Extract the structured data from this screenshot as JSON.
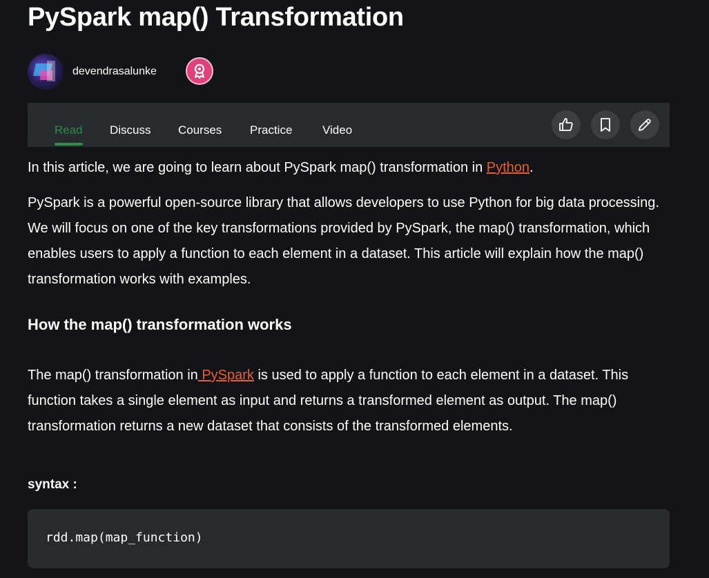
{
  "article": {
    "title": "PySpark map() Transformation",
    "author": "devendrasalunke"
  },
  "icons": {
    "badge": "award-badge-icon",
    "like": "thumbs-up-icon",
    "bookmark": "bookmark-icon",
    "edit": "pencil-icon"
  },
  "tabs": [
    {
      "label": "Read",
      "active": true
    },
    {
      "label": "Discuss",
      "active": false
    },
    {
      "label": "Courses",
      "active": false
    },
    {
      "label": "Practice",
      "active": false
    },
    {
      "label": "Video",
      "active": false
    }
  ],
  "content": {
    "intro": {
      "before": "In this article, we are going to learn about PySpark map() transformation in ",
      "link": "Python",
      "after": "."
    },
    "para1": "PySpark is a powerful open-source library that allows developers to use Python for big data processing. We will focus on one of the key transformations provided by PySpark, the map() transformation, which enables users to apply a function to each element in a dataset. This article will explain how the map() transformation works with examples.",
    "heading": "How the map() transformation works",
    "para2": {
      "before": "The map() transformation in",
      "link": " PySpark",
      "after": " is used to apply a function to each element in a dataset. This function takes a single element as input and returns a transformed element as output. The map() transformation returns a new dataset that consists of the transformed elements."
    },
    "syntax_label": "syntax :",
    "code": "rdd.map(map_function)"
  },
  "colors": {
    "background": "#131417",
    "accent_green": "#2f8d46",
    "link_orange": "#e85d35",
    "badge_pink": "#e0417b",
    "panel": "#272a2e"
  }
}
